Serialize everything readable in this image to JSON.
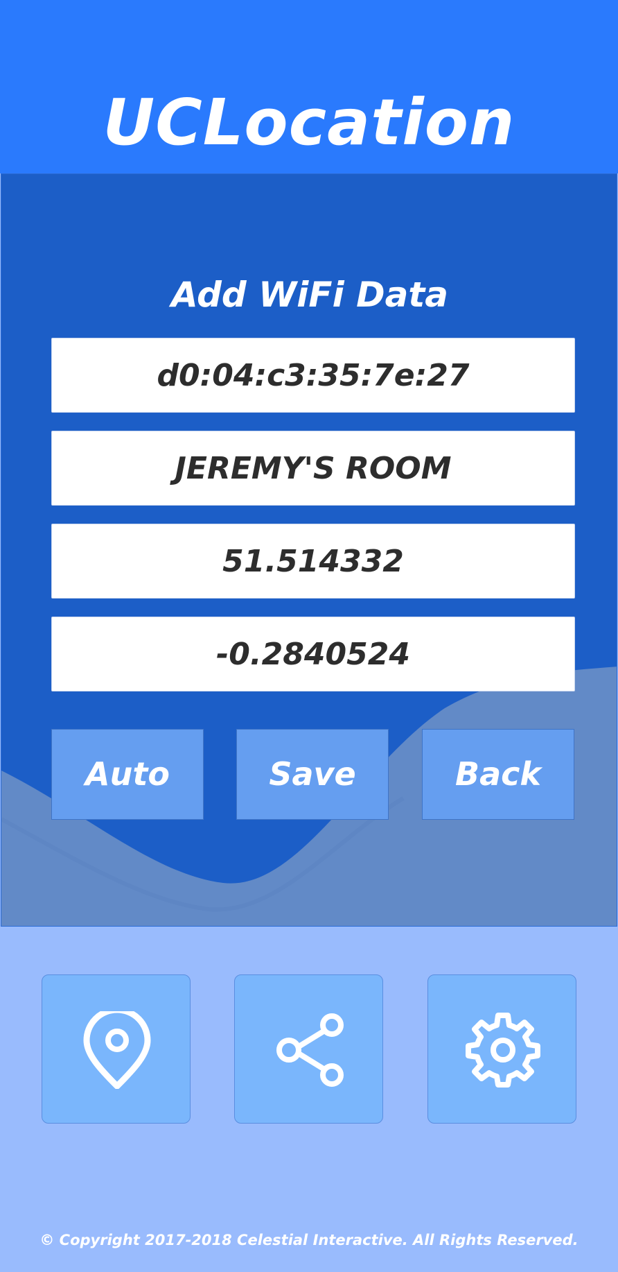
{
  "app": {
    "title": "UCLocation"
  },
  "form": {
    "title": "Add WiFi Data",
    "fields": [
      {
        "value": "d0:04:c3:35:7e:27"
      },
      {
        "value": "JEREMY'S ROOM"
      },
      {
        "value": "51.514332"
      },
      {
        "value": "-0.2840524"
      }
    ],
    "buttons": {
      "auto": "Auto",
      "save": "Save",
      "back": "Back"
    }
  },
  "nav": {
    "items": [
      {
        "icon": "location-pin-icon"
      },
      {
        "icon": "share-icon"
      },
      {
        "icon": "gear-icon"
      }
    ]
  },
  "footer": {
    "copyright": "© Copyright 2017-2018 Celestial Interactive. All Rights Reserved."
  },
  "colors": {
    "header": "#2a7afd",
    "panel": "#1c5ec7",
    "wave": "#628ac7",
    "button": "#659ef0",
    "tile": "#7ab6fc",
    "background": "#99bbfd"
  }
}
